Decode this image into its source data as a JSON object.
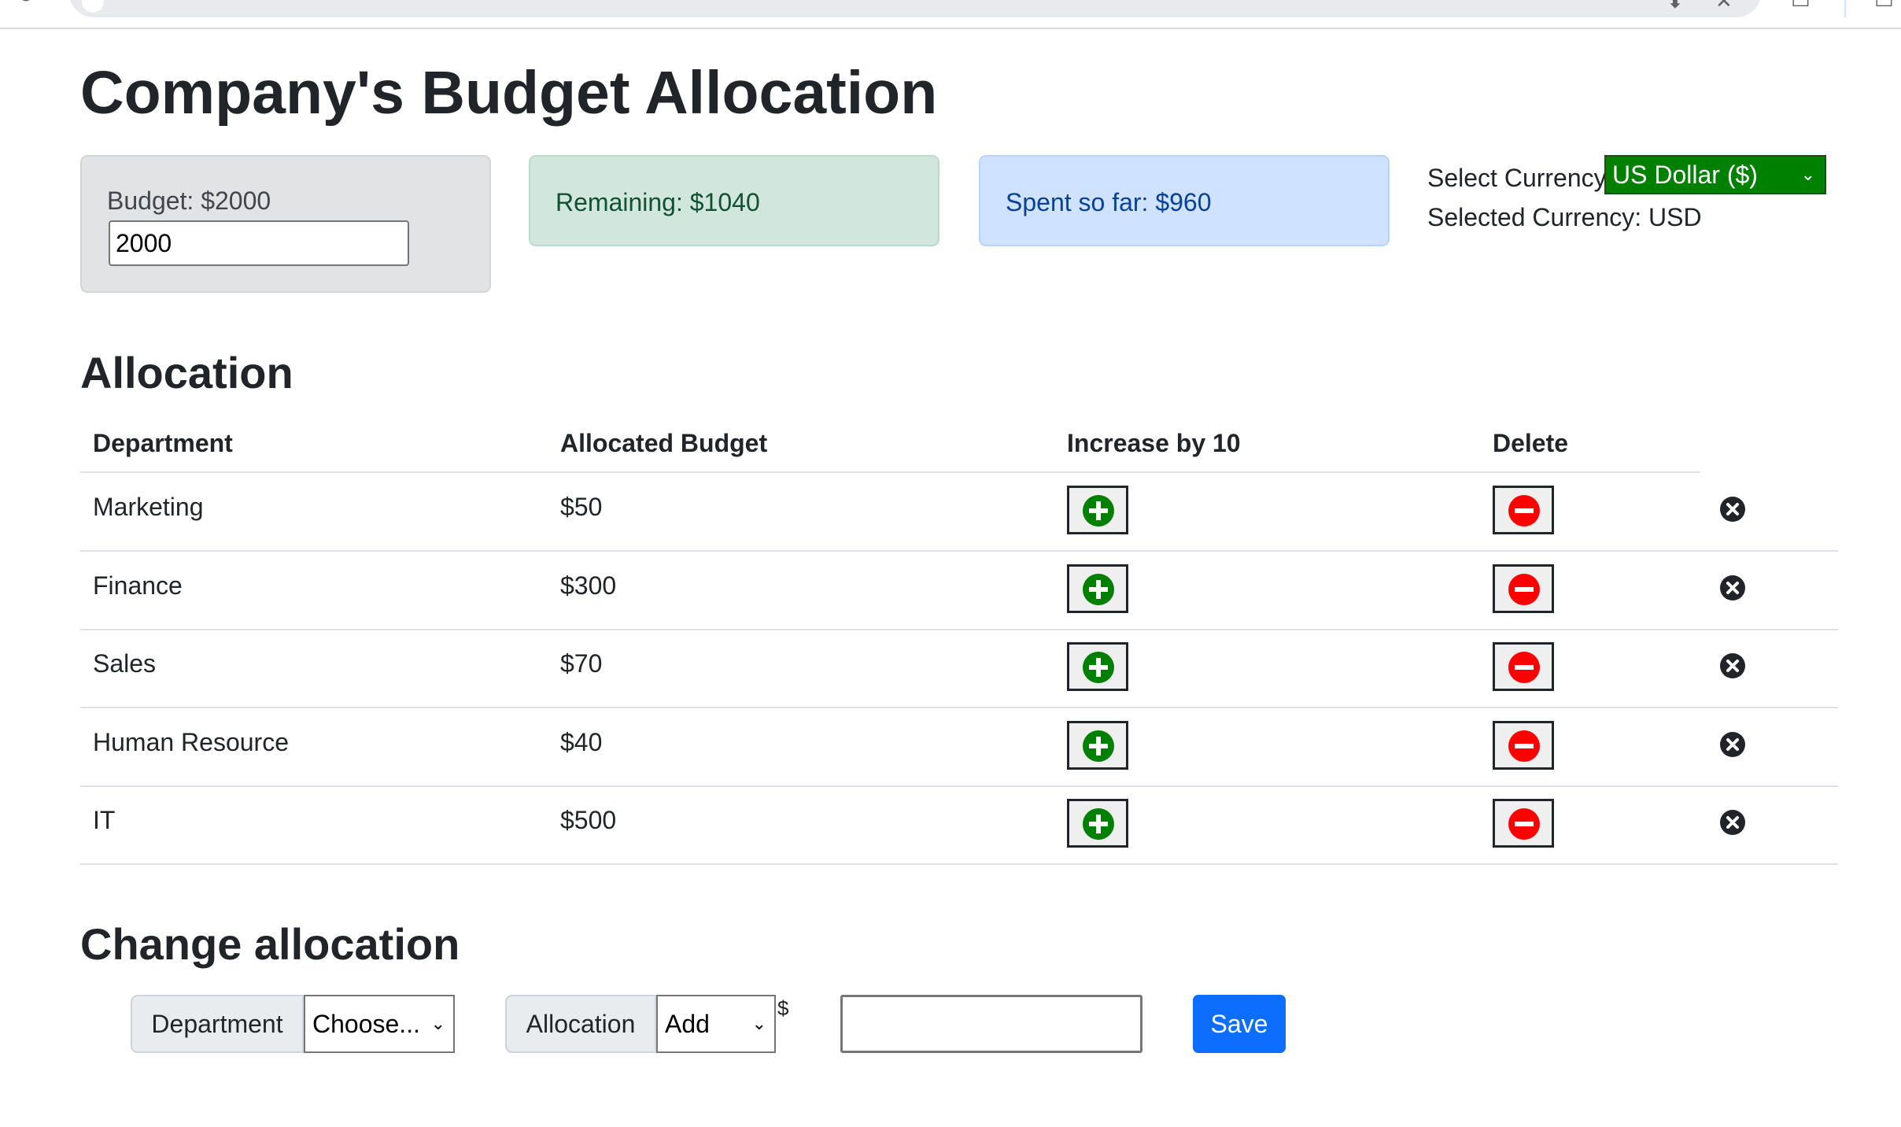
{
  "page": {
    "title": "Company's Budget Allocation"
  },
  "budget": {
    "label": "Budget: $2000",
    "input_value": "2000"
  },
  "remaining": {
    "label": "Remaining: $1040"
  },
  "spent": {
    "label": "Spent so far: $960"
  },
  "currency": {
    "select_label": "Select Currency:",
    "selected_option": "US Dollar ($)",
    "selected_text": "Selected Currency: USD"
  },
  "allocation": {
    "heading": "Allocation",
    "columns": [
      "Department",
      "Allocated Budget",
      "Increase by 10",
      "Delete"
    ],
    "rows": [
      {
        "department": "Marketing",
        "budget": "$50"
      },
      {
        "department": "Finance",
        "budget": "$300"
      },
      {
        "department": "Sales",
        "budget": "$70"
      },
      {
        "department": "Human Resource",
        "budget": "$40"
      },
      {
        "department": "IT",
        "budget": "$500"
      }
    ]
  },
  "change": {
    "heading": "Change allocation",
    "department_label": "Department",
    "department_select": "Choose...",
    "allocation_label": "Allocation",
    "allocation_select": "Add",
    "currency_symbol": "$",
    "amount_value": "",
    "save_label": "Save"
  },
  "colors": {
    "plus_button": "#008000",
    "minus_button": "#ff0000",
    "currency_select_bg": "#008000",
    "save_button": "#0d6efd"
  },
  "icons": {
    "increase": "plus-circle-icon",
    "decrease": "minus-circle-icon",
    "delete": "x-circle-icon"
  }
}
